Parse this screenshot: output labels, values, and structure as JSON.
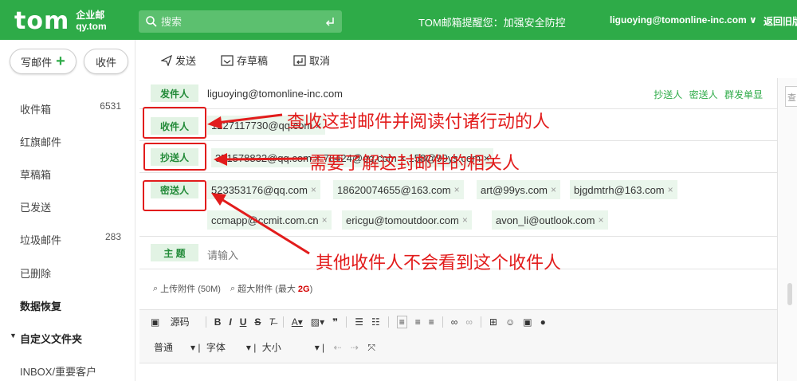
{
  "header": {
    "logo": "tom",
    "logo_sub1": "企业邮",
    "logo_sub2": "qy.tom",
    "search_placeholder": "搜索",
    "notice": "TOM邮箱提醒您：加强安全防控",
    "user": "liguoying@tomonline-inc.com ∨",
    "back": "返回旧版"
  },
  "sidebar": {
    "compose_label": "写邮件",
    "inbox_label": "收件",
    "items": [
      {
        "label": "收件箱",
        "count": "6531"
      },
      {
        "label": "红旗邮件",
        "count": ""
      },
      {
        "label": "草稿箱",
        "count": ""
      },
      {
        "label": "已发送",
        "count": ""
      },
      {
        "label": "垃圾邮件",
        "count": "283"
      },
      {
        "label": "已删除",
        "count": ""
      },
      {
        "label": "数据恢复",
        "count": ""
      },
      {
        "label": "自定义文件夹",
        "count": ""
      },
      {
        "label": "INBOX/重要客户",
        "count": ""
      }
    ]
  },
  "toolbar": {
    "send": "发送",
    "save_draft": "存草稿",
    "cancel": "取消"
  },
  "form": {
    "from_label": "发件人",
    "from_value": "liguoying@tomonline-inc.com",
    "links": [
      "抄送人",
      "密送人",
      "群发单显"
    ],
    "to_label": "收件人",
    "to_value": "1227117730@qq.com ×",
    "cc_label": "抄送人",
    "cc_value": "371578832@qq.com × 76424@qq.com × 158@99ys.com ×",
    "bcc_label": "密送人",
    "bcc_chips": [
      "523353176@qq.com",
      "18620074655@163.com",
      "art@99ys.com",
      "bjgdmtrh@163.com",
      "ccmapp@ccmit.com.cn",
      "ericgu@tomoutdoor.com",
      "avon_li@outlook.com"
    ],
    "subject_label": "主 题",
    "subject_placeholder": "请输入"
  },
  "annotations": {
    "to": "查收这封邮件并阅读付诸行动的人",
    "cc": "需要了解这封邮件的相关人",
    "bcc": "其他收件人不会看到这个收件人"
  },
  "attachments": {
    "upload": "上传附件 (50M)",
    "large_prefix": "超大附件 (最大 ",
    "large_size": "2G",
    "large_suffix": ")"
  },
  "editor": {
    "source": "源码",
    "format": "普通",
    "font": "字体",
    "size": "大小"
  },
  "right_panel": {
    "placeholder": "查"
  },
  "colors": {
    "brand": "#2eab48",
    "annotation": "#e21c1c"
  }
}
